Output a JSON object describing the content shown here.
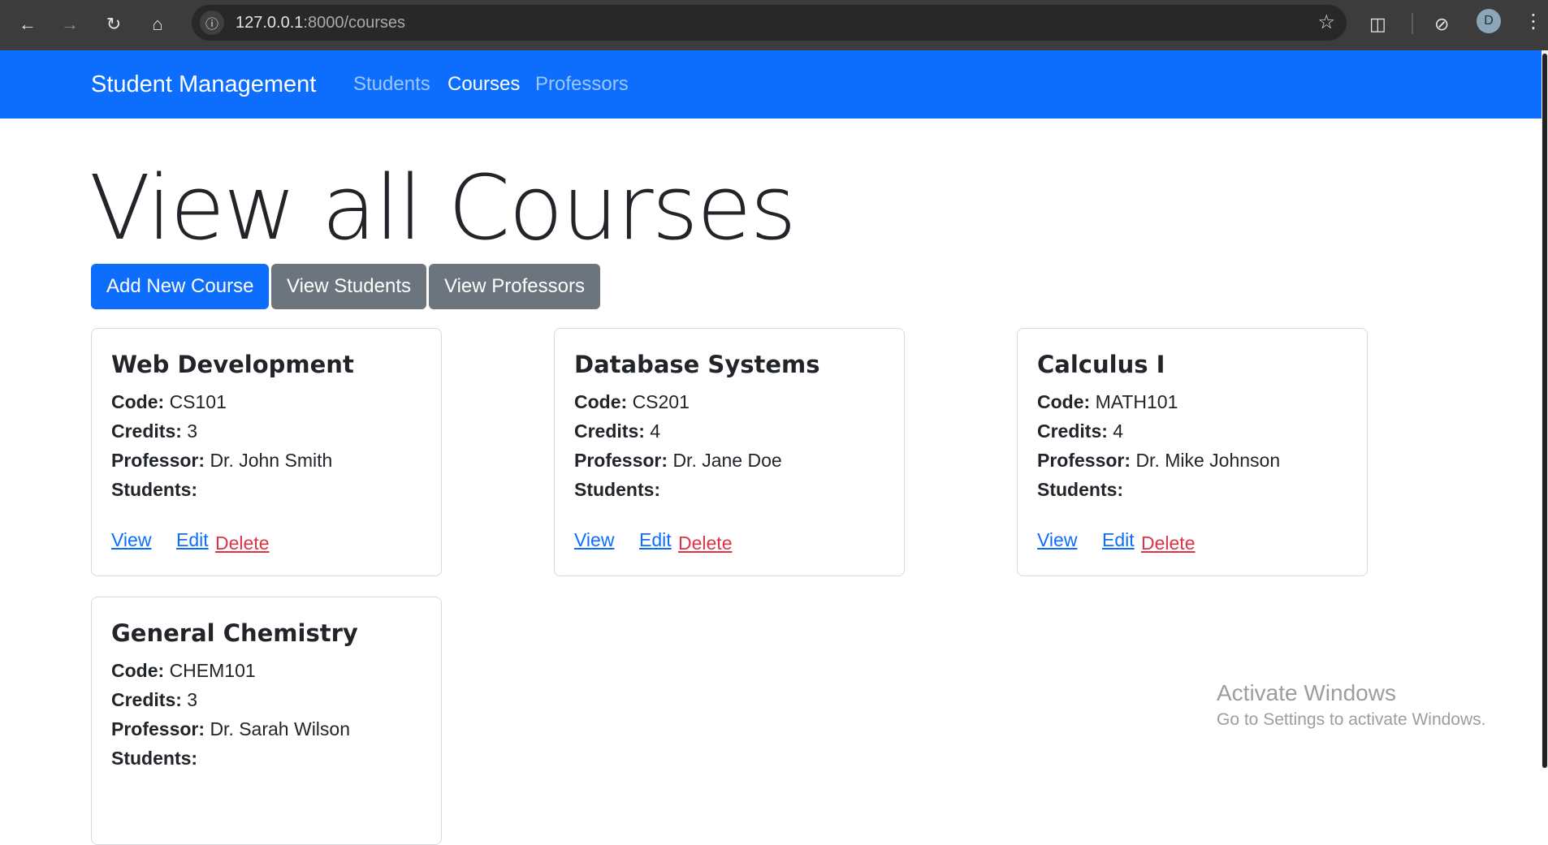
{
  "browser": {
    "url_host": "127.0.0.1",
    "url_rest": ":8000/courses",
    "avatar_letter": "D"
  },
  "navbar": {
    "brand": "Student Management",
    "links": [
      {
        "label": "Students",
        "active": false
      },
      {
        "label": "Courses",
        "active": true
      },
      {
        "label": "Professors",
        "active": false
      }
    ]
  },
  "page": {
    "title": "View all Courses",
    "buttons": {
      "add": "Add New Course",
      "students": "View Students",
      "professors": "View Professors"
    }
  },
  "labels": {
    "code": "Code:",
    "credits": "Credits:",
    "professor": "Professor:",
    "students": "Students:",
    "view": "View",
    "edit": "Edit",
    "delete": "Delete"
  },
  "courses": [
    {
      "name": "Web Development",
      "code": "CS101",
      "credits": "3",
      "professor": "Dr. John Smith"
    },
    {
      "name": "Database Systems",
      "code": "CS201",
      "credits": "4",
      "professor": "Dr. Jane Doe"
    },
    {
      "name": "Calculus I",
      "code": "MATH101",
      "credits": "4",
      "professor": "Dr. Mike Johnson"
    },
    {
      "name": "General Chemistry",
      "code": "CHEM101",
      "credits": "3",
      "professor": "Dr. Sarah Wilson"
    }
  ],
  "watermark": {
    "line1": "Activate Windows",
    "line2": "Go to Settings to activate Windows."
  },
  "colors": {
    "primary": "#0d6efd",
    "secondary": "#6c757d",
    "danger": "#dc3545"
  }
}
